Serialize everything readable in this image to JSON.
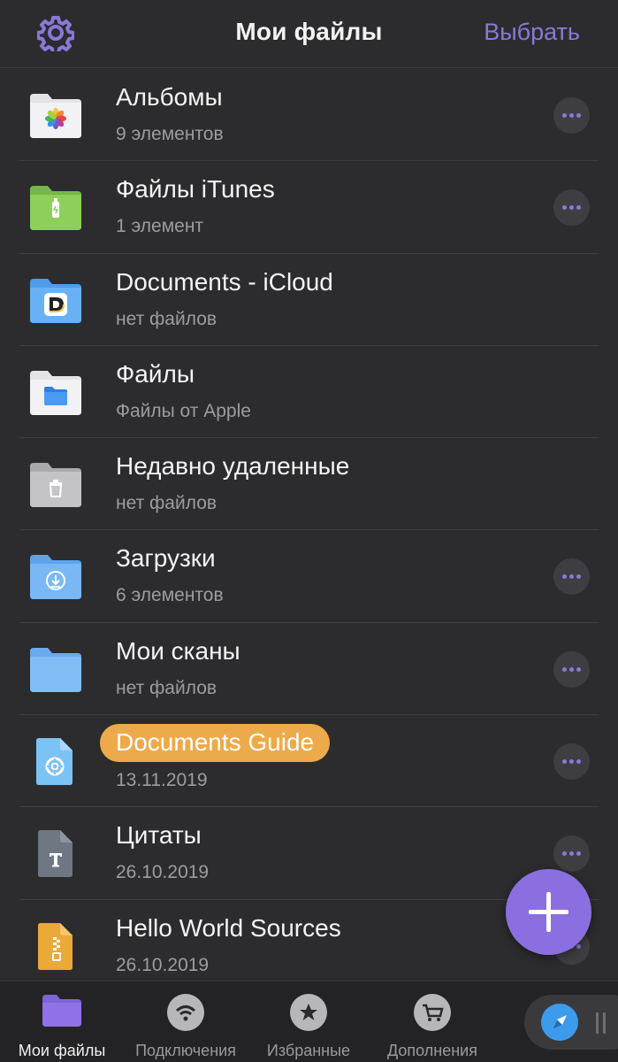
{
  "header": {
    "title": "Мои файлы",
    "select_label": "Выбрать",
    "settings_icon": "gear-icon",
    "accent_color": "#8b78d8"
  },
  "items": [
    {
      "name": "Альбомы",
      "subtitle": "9 элементов",
      "icon": "photos-folder-icon",
      "has_more": true
    },
    {
      "name": "Файлы iTunes",
      "subtitle": "1 элемент",
      "icon": "itunes-folder-icon",
      "has_more": true
    },
    {
      "name": "Documents - iCloud",
      "subtitle": "нет файлов",
      "icon": "icloud-documents-folder-icon",
      "has_more": false
    },
    {
      "name": "Файлы",
      "subtitle": "Файлы от Apple",
      "icon": "apple-files-folder-icon",
      "has_more": false
    },
    {
      "name": "Недавно удаленные",
      "subtitle": "нет файлов",
      "icon": "trash-folder-icon",
      "has_more": false
    },
    {
      "name": "Загрузки",
      "subtitle": "6 элементов",
      "icon": "downloads-folder-icon",
      "has_more": true
    },
    {
      "name": "Мои сканы",
      "subtitle": "нет файлов",
      "icon": "scans-folder-icon",
      "has_more": true
    },
    {
      "name": "Documents Guide",
      "subtitle": "13.11.2019",
      "icon": "guide-document-icon",
      "has_more": true,
      "highlighted": true
    },
    {
      "name": "Цитаты",
      "subtitle": "26.10.2019",
      "icon": "text-document-icon",
      "has_more": true
    },
    {
      "name": "Hello World Sources",
      "subtitle": "26.10.2019",
      "icon": "zip-archive-icon",
      "has_more": true
    }
  ],
  "fab": {
    "icon": "plus-icon",
    "color": "#8b6fe0"
  },
  "tabs": [
    {
      "label": "Мои файлы",
      "icon": "folder-icon",
      "active": true
    },
    {
      "label": "Подключения",
      "icon": "wifi-icon",
      "active": false
    },
    {
      "label": "Избранные",
      "icon": "star-icon",
      "active": false
    },
    {
      "label": "Дополнения",
      "icon": "cart-icon",
      "active": false
    }
  ],
  "browser_button": {
    "icon": "compass-icon"
  }
}
